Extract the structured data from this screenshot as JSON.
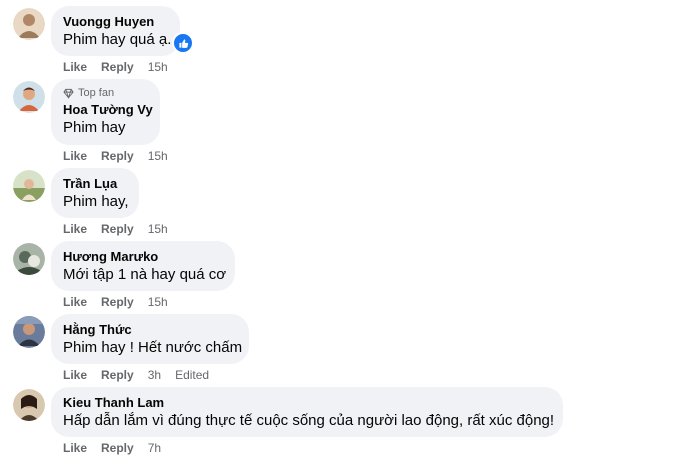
{
  "comments": [
    {
      "author": "Vuongg Huyen",
      "text": "Phim hay quá ạ.",
      "badge": "",
      "actions": {
        "like": "Like",
        "reply": "Reply"
      },
      "time": "15h",
      "edited": "",
      "reaction": "like-reaction-icon",
      "avatar_color": "#c7a88a"
    },
    {
      "author": "Hoa Tường Vy",
      "text": "Phim hay",
      "badge": "Top fan",
      "actions": {
        "like": "Like",
        "reply": "Reply"
      },
      "time": "15h",
      "edited": "",
      "avatar_color": "#d9a07a"
    },
    {
      "author": "Trần Lụa",
      "text": "Phim hay,",
      "badge": "",
      "actions": {
        "like": "Like",
        "reply": "Reply"
      },
      "time": "15h",
      "edited": "",
      "avatar_color": "#b8c2a0"
    },
    {
      "author": "Hương Marưko",
      "text": "Mới tập 1 nà hay quá cơ",
      "badge": "",
      "actions": {
        "like": "Like",
        "reply": "Reply"
      },
      "time": "15h",
      "edited": "",
      "avatar_color": "#7a8a7a"
    },
    {
      "author": "Hằng Thức",
      "text": "Phim hay ! Hết nước chấm",
      "badge": "",
      "actions": {
        "like": "Like",
        "reply": "Reply"
      },
      "time": "3h",
      "edited": "Edited",
      "avatar_color": "#5a6a8a"
    },
    {
      "author": "Kieu Thanh Lam",
      "text": "Hấp dẫn lắm vì đúng thực tế cuộc sống của người lao động, rất xúc động!",
      "badge": "",
      "actions": {
        "like": "Like",
        "reply": "Reply"
      },
      "time": "7h",
      "edited": "",
      "avatar_color": "#6a5a4a"
    }
  ],
  "colors": {
    "bubble": "#f0f2f5",
    "secondary_text": "#65676b",
    "like_blue": "#1877f2"
  }
}
